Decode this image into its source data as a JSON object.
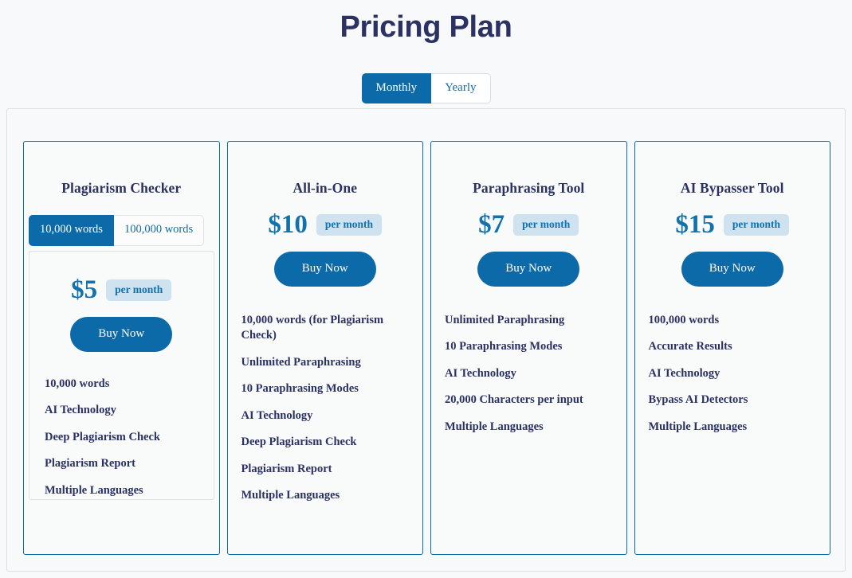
{
  "header": {
    "title": "Pricing Plan"
  },
  "billing_toggle": {
    "options": [
      {
        "label": "Monthly",
        "active": true
      },
      {
        "label": "Yearly",
        "active": false
      }
    ]
  },
  "colors": {
    "accent_blue": "#0d6aa8",
    "price_blue": "#1272ad",
    "badge_bg": "#cfe2f0",
    "title_navy": "#2b3263",
    "page_bg": "#f8f9fa",
    "card_border": "#0d6aa8"
  },
  "plans": [
    {
      "name": "Plagiarism Checker",
      "has_word_tabs": true,
      "word_tabs": [
        {
          "label": "10,000 words",
          "active": true
        },
        {
          "label": "100,000 words",
          "active": false
        }
      ],
      "price": "$5",
      "period": "per month",
      "cta": "Buy Now",
      "features": [
        "10,000 words",
        "AI Technology",
        "Deep Plagiarism Check",
        "Plagiarism Report",
        "Multiple Languages"
      ]
    },
    {
      "name": "All-in-One",
      "has_word_tabs": false,
      "price": "$10",
      "period": "per month",
      "cta": "Buy Now",
      "features": [
        "10,000 words (for Plagiarism Check)",
        "Unlimited Paraphrasing",
        "10 Paraphrasing Modes",
        "AI Technology",
        "Deep Plagiarism Check",
        "Plagiarism Report",
        "Multiple Languages"
      ]
    },
    {
      "name": "Paraphrasing Tool",
      "has_word_tabs": false,
      "price": "$7",
      "period": "per month",
      "cta": "Buy Now",
      "features": [
        "Unlimited Paraphrasing",
        "10 Paraphrasing Modes",
        "AI Technology",
        "20,000 Characters per input",
        "Multiple Languages"
      ]
    },
    {
      "name": "AI Bypasser Tool",
      "has_word_tabs": false,
      "price": "$15",
      "period": "per month",
      "cta": "Buy Now",
      "features": [
        "100,000 words",
        "Accurate Results",
        "AI Technology",
        "Bypass AI Detectors",
        "Multiple Languages"
      ]
    }
  ]
}
